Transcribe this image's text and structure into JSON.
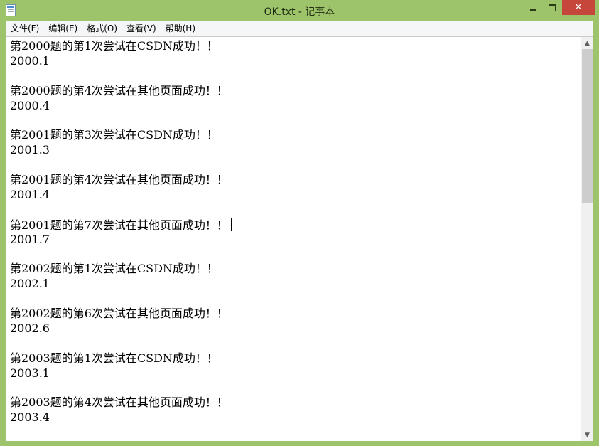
{
  "window": {
    "title": "OK.txt - 记事本",
    "icon": "notepad-icon",
    "controls": {
      "minimize": "minimize-icon",
      "maximize": "maximize-icon",
      "close": "✕"
    }
  },
  "menu": {
    "items": [
      "文件(F)",
      "编辑(E)",
      "格式(O)",
      "查看(V)",
      "帮助(H)"
    ]
  },
  "document": {
    "lines": [
      "第2000题的第1次尝试在CSDN成功！！",
      "2000.1",
      "",
      "第2000题的第4次尝试在其他页面成功！！",
      "2000.4",
      "",
      "第2001题的第3次尝试在CSDN成功！！",
      "2001.3",
      "",
      "第2001题的第4次尝试在其他页面成功！！",
      "2001.4",
      "",
      "第2001题的第7次尝试在其他页面成功！！",
      "2001.7",
      "",
      "第2002题的第1次尝试在CSDN成功！！",
      "2002.1",
      "",
      "第2002题的第6次尝试在其他页面成功！！",
      "2002.6",
      "",
      "第2003题的第1次尝试在CSDN成功！！",
      "2003.1",
      "",
      "第2003题的第4次尝试在其他页面成功！！",
      "2003.4"
    ],
    "caret_line": 12
  },
  "scrollbar": {
    "up_arrow": "▲",
    "down_arrow": "▼",
    "position": 0.0
  },
  "colors": {
    "window_frame": "#9dc46b",
    "close_button": "#c7463c",
    "menubar": "#f5f6f7",
    "editor_bg": "#ffffff"
  }
}
